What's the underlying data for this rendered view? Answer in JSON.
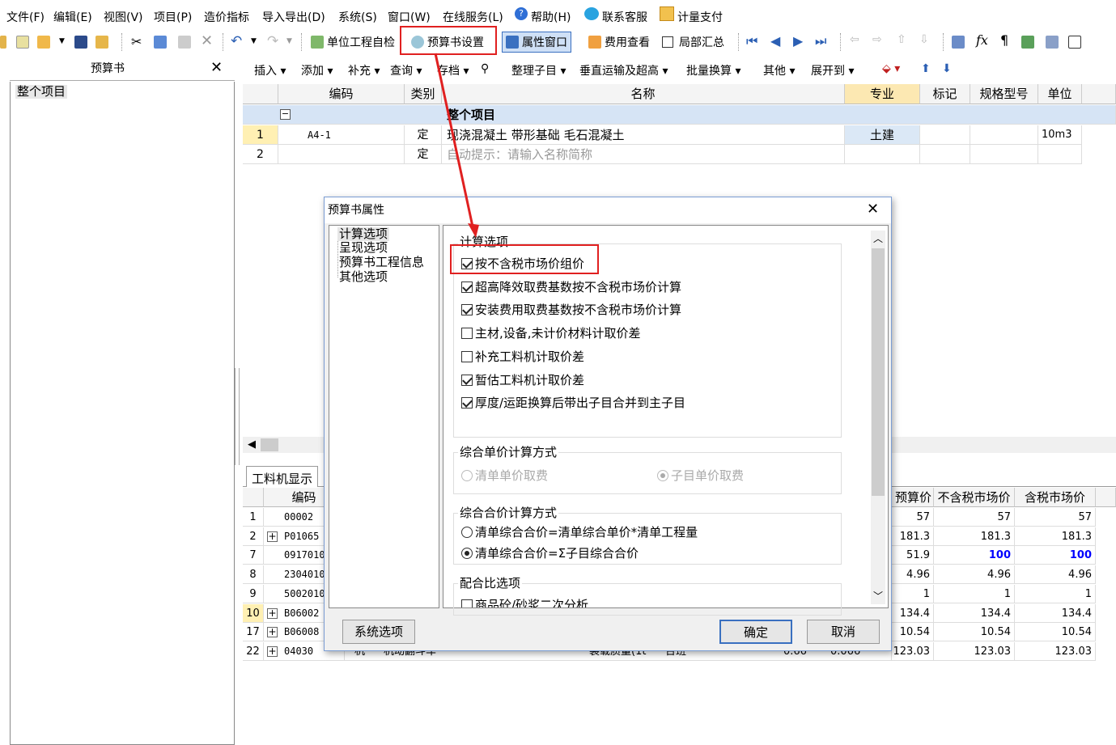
{
  "menu": [
    "文件(F)",
    "编辑(E)",
    "视图(V)",
    "项目(P)",
    "造价指标",
    "导入导出(D)",
    "系统(S)",
    "窗口(W)",
    "在线服务(L)",
    "帮助(H)",
    "联系客服",
    "计量支付"
  ],
  "toolbar": {
    "unit_check": "单位工程自检",
    "budget_settings": "预算书设置",
    "property_window": "属性窗口",
    "fee_view": "费用查看",
    "partial_summary": "局部汇总"
  },
  "left_panel": {
    "title": "预算书",
    "close": "✕",
    "tree_root": "整个项目"
  },
  "toolbar2": [
    "插入",
    "添加",
    "补充",
    "查询",
    "存档",
    "整理子目",
    "垂直运输及超高",
    "批量换算",
    "其他",
    "展开到"
  ],
  "grid1": {
    "headers": [
      "编码",
      "类别",
      "名称",
      "专业",
      "标记",
      "规格型号",
      "单位"
    ],
    "group_row": "整个项目",
    "rows": [
      {
        "num": "1",
        "code": "A4-1",
        "type": "定",
        "name": "现浇混凝土 带形基础 毛石混凝土",
        "major": "土建",
        "unit": "10m3"
      },
      {
        "num": "2",
        "code": "",
        "type": "定",
        "name": "自动提示：请输入名称简称",
        "major": "",
        "unit": ""
      }
    ]
  },
  "lower_tab": "工料机显示",
  "grid2": {
    "headers": [
      "编码",
      "预算价",
      "不含税市场价",
      "含税市场价"
    ],
    "rows": [
      {
        "num": "1",
        "plus": false,
        "code": "00002",
        "budget": "57",
        "notax": "57",
        "tax": "57",
        "hl": false
      },
      {
        "num": "2",
        "plus": true,
        "code": "P01065",
        "budget": "181.3",
        "notax": "181.3",
        "tax": "181.3",
        "hl": false
      },
      {
        "num": "7",
        "plus": false,
        "code": "0917010",
        "budget": "51.9",
        "notax": "100",
        "tax": "100",
        "hl": true
      },
      {
        "num": "8",
        "plus": false,
        "code": "2304010",
        "budget": "4.96",
        "notax": "4.96",
        "tax": "4.96",
        "hl": false
      },
      {
        "num": "9",
        "plus": false,
        "code": "5002010",
        "budget": "1",
        "notax": "1",
        "tax": "1",
        "hl": false
      },
      {
        "num": "10",
        "plus": true,
        "code": "B06002",
        "budget": "134.4",
        "notax": "134.4",
        "tax": "134.4",
        "hl": false
      },
      {
        "num": "17",
        "plus": true,
        "code": "B06008",
        "budget": "10.54",
        "notax": "10.54",
        "tax": "10.54",
        "hl": false
      },
      {
        "num": "22",
        "plus": true,
        "code": "04030",
        "budget": "123.03",
        "notax": "123.03",
        "tax": "123.03",
        "hl": false
      }
    ],
    "last_row_extra": {
      "type": "机",
      "name": "机动翻斗车",
      "spec": "装载质量(1t",
      "unit": "台班",
      "q1": "0.66",
      "q2": "0.066"
    }
  },
  "dialog": {
    "title": "预算书属性",
    "close": "✕",
    "tree": [
      "计算选项",
      "呈现选项",
      "预算书工程信息",
      "其他选项"
    ],
    "group1": "计算选项",
    "checks": [
      {
        "label": "按不含税市场价组价",
        "checked": true
      },
      {
        "label": "超高降效取费基数按不含税市场价计算",
        "checked": true
      },
      {
        "label": "安装费用取费基数按不含税市场价计算",
        "checked": true
      },
      {
        "label": "主材,设备,未计价材料计取价差",
        "checked": false
      },
      {
        "label": "补充工料机计取价差",
        "checked": false
      },
      {
        "label": "暂估工料机计取价差",
        "checked": true
      },
      {
        "label": "厚度/运距换算后带出子目合并到主子目",
        "checked": true
      }
    ],
    "group2": "综合单价计算方式",
    "g2_opt1": "清单单价取费",
    "g2_opt2": "子目单价取费",
    "group3": "综合合价计算方式",
    "g3_opt1": "清单综合合价=清单综合单价*清单工程量",
    "g3_opt2": "清单综合合价=Σ子目综合合价",
    "group4": "配合比选项",
    "g4_opt1": "商品砼/砂浆二次分析",
    "btn_system": "系统选项",
    "btn_ok": "确定",
    "btn_cancel": "取消"
  },
  "colors": {
    "highlight_col": "#fce8b2",
    "row_hl": "#fff0b3",
    "blue_val": "#0000ff",
    "red_annot": "#e02020",
    "group_row": "#d6e4f5"
  }
}
